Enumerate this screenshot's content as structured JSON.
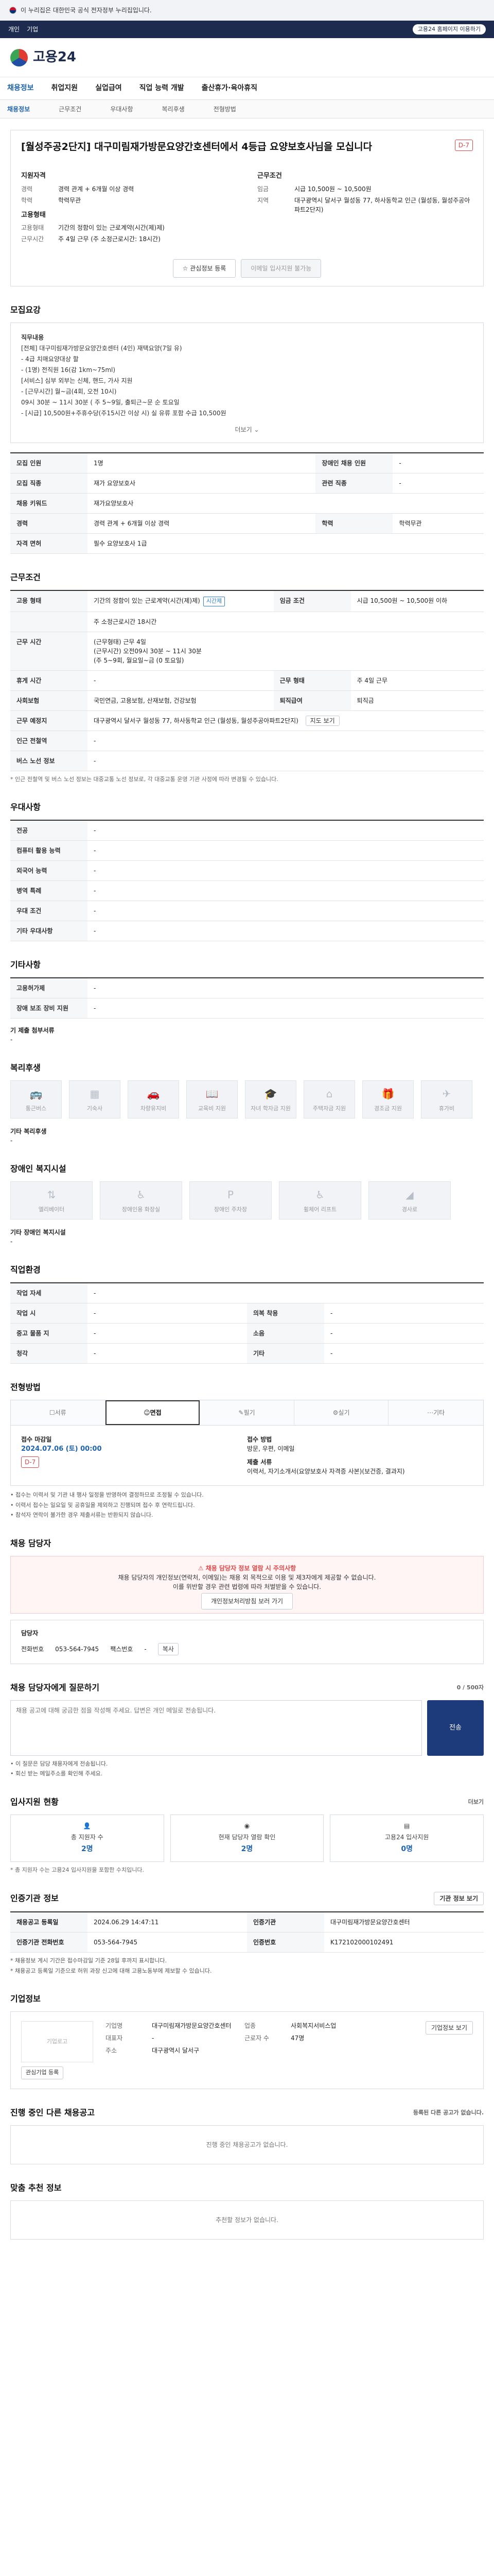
{
  "gov": {
    "text": "이 누리집은 대한민국 공식 전자정부 누리집입니다."
  },
  "topbar": {
    "items": [
      "개인",
      "기업"
    ],
    "right": "고용24 홈페이지 이용하기"
  },
  "header": {
    "logo": "고용24"
  },
  "gnb": [
    "채용정보",
    "취업지원",
    "실업급여",
    "직업 능력 개발",
    "출산휴가·육아휴직"
  ],
  "lnb": [
    "채용정보",
    "근무조건",
    "우대사항",
    "복리후생",
    "전형방법"
  ],
  "job": {
    "title": "[월성주공2단지] 대구미림재가방문요양간호센터에서 4등급 요양보호사님을 모십니다",
    "dday": "D-7",
    "left_head": "지원자격",
    "exp_k": "경력",
    "exp_v": "경력 관계 + 6개월 이상 경력",
    "edu_k": "학력",
    "edu_v": "학력무관",
    "right_head": "근무조건",
    "pay_k": "임금",
    "pay_v": "시급 10,500원 ~ 10,500원",
    "area_k": "지역",
    "area_v": "대구광역시 달서구 월성동 77, 하사동학교 인근 (월성동, 월성주공아파트2단지)",
    "emp_head": "고용형태",
    "emp_k": "고용형태",
    "emp_v": "기간의 정함이 있는 근로계약(시간(제)제)",
    "time_k": "근무시간",
    "time_v": "주 4일 근무 (주 소정근로시간: 18시간)",
    "btn_apply": "관심정보 등록",
    "btn_online": "이메일 입사지원 불가능"
  },
  "recruit": {
    "section": "모집요강",
    "job_head": "직무내용",
    "desc": [
      "[전체] 대구미림재가방문요양간호센터 (4인) 재택요양(7일 유)",
      "- 4급 치매요양대상 할",
      "- (1명) 전직원 16(감 1km~75ml)",
      "",
      "[서비스] 심부 외부는 신체, 핸드, 가사 지원",
      "- [근무시간] 월~금(4회, 오전 10시)",
      "  09시 30분 ~ 11시 30분 ( 주 5~9일, 출퇴근~문 순 토요일",
      "- [시급] 10,500원+주휴수당(주15시간 이상 시) 실 유류 포함 수급 10,500원"
    ],
    "more": "더보기",
    "rows": [
      {
        "k": "모집 인원",
        "v": "1명",
        "k2": "장애인 채용 인원",
        "v2": "-"
      },
      {
        "k": "모집 직종",
        "v": "재가 요양보호사",
        "k2": "관련 직종",
        "v2": "-"
      },
      {
        "k": "채용 키워드",
        "v": "재가요양보호사",
        "k2": "",
        "v2": ""
      },
      {
        "k": "경력",
        "v": "경력 관계 + 6개월 이상 경력",
        "k2": "학력",
        "v2": "학력무관"
      },
      {
        "k": "자격 면허",
        "v": "필수   요양보호사 1급",
        "k2": "",
        "v2": ""
      }
    ]
  },
  "work": {
    "section": "근무조건",
    "type_k": "고용 형태",
    "type_v": "기간의 정함이 있는 근로계약(시간(제)제)",
    "type_tag": "시간제",
    "pay_k": "임금 조건",
    "pay_v": "시급 10,500원 ~ 10,500원 이하",
    "insurance": "주 소정근로시간  18시간",
    "time_k": "근무 시간",
    "time_lines": [
      "(근무형태) 근무 4일",
      "(근무시간) 오전09시 30분 ~ 11시 30분",
      "(주 5~9회, 월요일~금 (0 토요일)"
    ],
    "week_k": "주 4일 근무",
    "rows": [
      {
        "k": "휴게 시간",
        "v": "-",
        "k2": "근무 형태",
        "v2": "주 4일 근무"
      },
      {
        "k": "사회보험",
        "v": "국민연금, 고용보험, 산재보험, 건강보험",
        "k2": "퇴직급여",
        "v2": "퇴직금"
      },
      {
        "k": "근무 예정지",
        "v": "대구광역시 달서구 월성동 77, 하사동학교 인근 (월성동, 월성주공아파트2단지)",
        "k2": "",
        "v2": ""
      },
      {
        "k": "인근 전철역",
        "v": "-",
        "k2": "",
        "v2": ""
      },
      {
        "k": "버스 노선 정보",
        "v": "-",
        "k2": "",
        "v2": ""
      }
    ],
    "map_btn": "지도 보기",
    "note": "* 인근 전철역 및 버스 노선 정보는 대중교통 노선 정보로, 각 대중교통 운영 기관 사정에 따라 변경될 수 있습니다."
  },
  "prefer": {
    "section": "우대사항",
    "rows": [
      {
        "k": "전공",
        "v": "-"
      },
      {
        "k": "컴퓨터 활용 능력",
        "v": "-"
      },
      {
        "k": "외국어 능력",
        "v": "-"
      },
      {
        "k": "병역 특례",
        "v": "-"
      },
      {
        "k": "우대 조건",
        "v": "-"
      },
      {
        "k": "기타 우대사항",
        "v": "-"
      }
    ]
  },
  "etc": {
    "section": "기타사항",
    "rows": [
      {
        "k": "고용허가제",
        "v": "-"
      },
      {
        "k": "장애 보조 장비 지원",
        "v": "-"
      }
    ],
    "extra_head": "기 제출 첨부서류",
    "extra_v": "-"
  },
  "welfare": {
    "section": "복리후생",
    "items": [
      "통근버스",
      "기숙사",
      "차량유지비",
      "교육비 지원",
      "자녀 학자금 지원",
      "주택자금 지원",
      "경조금 지원",
      "휴가비"
    ],
    "etc_head": "기타 복리후생",
    "etc_v": "-"
  },
  "disabled": {
    "section": "장애인 복지시설",
    "items": [
      "엘리베이터",
      "장애인용 화장실",
      "장애인 주차장",
      "휠체어 리프트",
      "경사로"
    ],
    "etc_head": "기타 장애인 복지시설",
    "etc_v": "-"
  },
  "jobcond": {
    "section": "직업환경",
    "rows": [
      {
        "k": "작업 자세",
        "v": "-",
        "k2": "",
        "v2": ""
      },
      {
        "k": "작업 시",
        "v": "-",
        "k2": "의복 착용",
        "v2": "-"
      },
      {
        "k": "중고 물품 지",
        "v": "-",
        "k2": "소음",
        "v2": "-"
      },
      {
        "k": "청각",
        "v": "-",
        "k2": "기타",
        "v2": "-"
      }
    ]
  },
  "process": {
    "section": "전형방법",
    "tabs": [
      "서류",
      "면접",
      "필기",
      "실기",
      "기타"
    ],
    "active": 1,
    "deadline_k": "접수 마감일",
    "deadline_v": "2024.07.06 (토) 00:00",
    "deadline_badge": "D-7",
    "method_k": "접수 방법",
    "method_v": "방문, 우편, 이메일",
    "doc_k": "제출 서류",
    "doc_v": "이력서, 자기소개서(요양보호사 자격증 사본)(보건증, 결과지)",
    "bullets": [
      "• 접수는 이력서 및 기관 내 행사 일정을 반영하여 결정하므로 조정될 수 있습니다.",
      "• 이력서 접수는 일요일 및 공휴일을 제외하고 진행되며 접수 후 연락드립니다.",
      "• 참석자 연락이 불가한 경우 제출서류는 반환되지 않습니다."
    ]
  },
  "manager": {
    "section": "채용 담당자",
    "alert1": "채용 담당자 정보 열람 시 주의사항",
    "alert2": "채용 담당자의 개인정보(연락처, 이메일)는 채용 외 목적으로 이용 및 제3자에게 제공할 수 없습니다.",
    "alert3": "이를 위반할 경우 관련 법령에 따라 처벌받을 수 있습니다.",
    "alert_btn": "개인정보처리방침 보러 가기",
    "dept_k": "담당자",
    "phone_k": "전화번호",
    "phone_v": "053-564-7945",
    "fax_k": "팩스번호",
    "fax_v": "-",
    "copy": "복사"
  },
  "inquiry": {
    "section": "채용 담당자에게 질문하기",
    "count": "0 / 500자",
    "placeholder": "채용 공고에 대해 궁금한 점을 작성해 주세요. 답변은 개인 메일로 전송됩니다.",
    "submit": "전송",
    "notes": [
      "• 이 질문은 담당 채용자에게 전송됩니다.",
      "• 회신 받는 메일주소를 확인해 주세요."
    ]
  },
  "stats": {
    "section": "입사지원 현황",
    "more": "더보기",
    "items": [
      {
        "label": "총 지원자 수",
        "value": "2명"
      },
      {
        "label": "현재 담당자 열람 확인",
        "value": "2명"
      },
      {
        "label": "고용24 입사지원",
        "value": "0명"
      }
    ],
    "note": "* 총 지원자 수는 고용24 입사지원을 포함한 수치입니다."
  },
  "cert": {
    "section": "인증기관 정보",
    "btn": "기관 정보 보기",
    "rows": [
      {
        "k": "채용공고 등록일",
        "v": "2024.06.29 14:47:11",
        "k2": "인증기관",
        "v2": "대구미림재가방문요양간호센터"
      },
      {
        "k": "인증기관 전화번호",
        "v": "053-564-7945",
        "k2": "인증번호",
        "v2": "K172102000102491"
      }
    ],
    "notes": [
      "* 채용정보 게시 기간은 접수마감일 기준 28일 후까지 표시합니다.",
      "* 채용공고 등록일 기준으로 허위 과장 신고에 대해 고용노동부에 제보할 수 있습니다."
    ]
  },
  "company": {
    "section": "기업정보",
    "logo": "기업로고",
    "rows": [
      {
        "k": "기업명",
        "v": "대구미림재가방문요양간호센터",
        "k2": "업종",
        "v2": "사회복지서비스업"
      },
      {
        "k": "대표자",
        "v": "-",
        "k2": "근로자 수",
        "v2": "47명"
      },
      {
        "k": "주소",
        "v": "대구광역시 달서구",
        "k2": "",
        "v2": ""
      }
    ],
    "btn1": "관심기업 등록",
    "btn2": "기업정보 보기"
  },
  "recent": {
    "section": "진행 중인 다른 채용공고",
    "note": "등록된 다른 공고가 없습니다.",
    "empty": "진행 중인 채용공고가 없습니다."
  },
  "recommend": {
    "section": "맞춤 추천 정보",
    "empty": "추천할 정보가 없습니다."
  }
}
